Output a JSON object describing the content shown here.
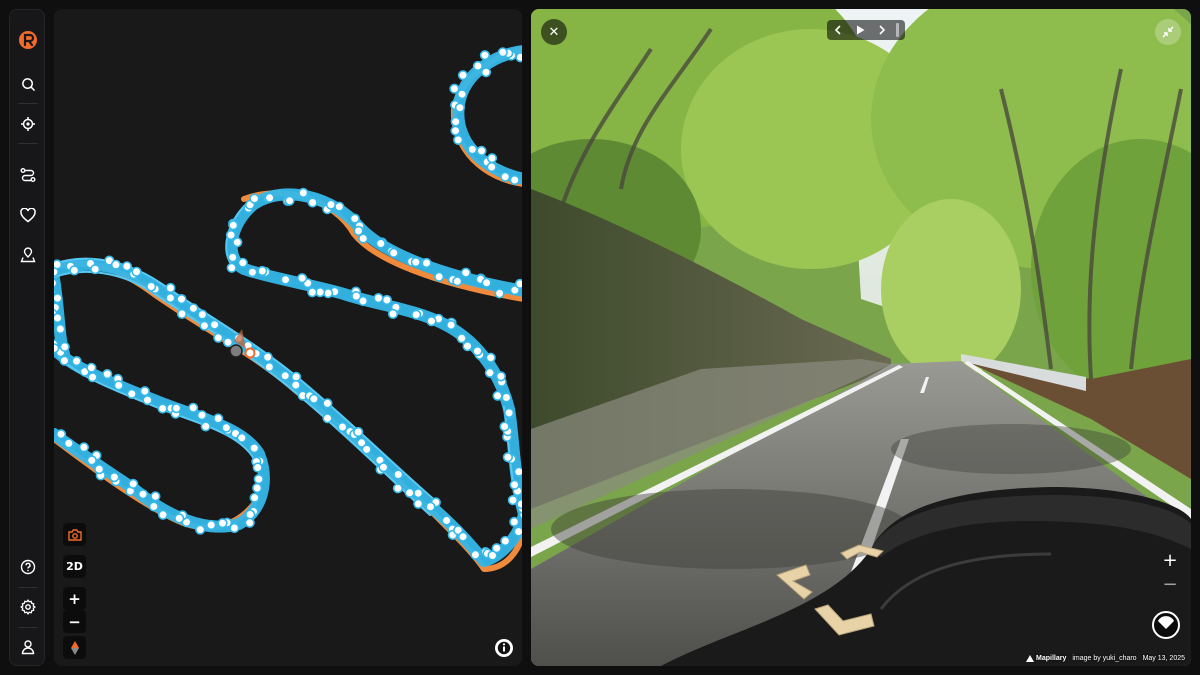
{
  "sidebar": {
    "logo": "r-logo-icon",
    "items": [
      {
        "icon": "search-icon"
      },
      {
        "icon": "locate-target-icon"
      },
      {
        "icon": "route-icon"
      },
      {
        "icon": "heart-icon"
      },
      {
        "icon": "map-pin-icon"
      }
    ],
    "bottom_items": [
      {
        "icon": "help-icon"
      },
      {
        "icon": "settings-gear-icon"
      },
      {
        "icon": "user-icon"
      }
    ]
  },
  "map": {
    "controls": {
      "view_mode_label": "2D",
      "zoom_in": "+",
      "zoom_out": "−"
    },
    "colors": {
      "background": "#19191a",
      "photo_track": "#35b8e9",
      "route": "#f08a3c",
      "point_fill": "#ffffff"
    }
  },
  "viewer": {
    "close_label": "✕",
    "zoom_in": "+",
    "zoom_out": "−",
    "attribution_brand": "Mapillary",
    "attribution_text": "image by yuki_charo",
    "capture_date": "May 13, 2025"
  }
}
